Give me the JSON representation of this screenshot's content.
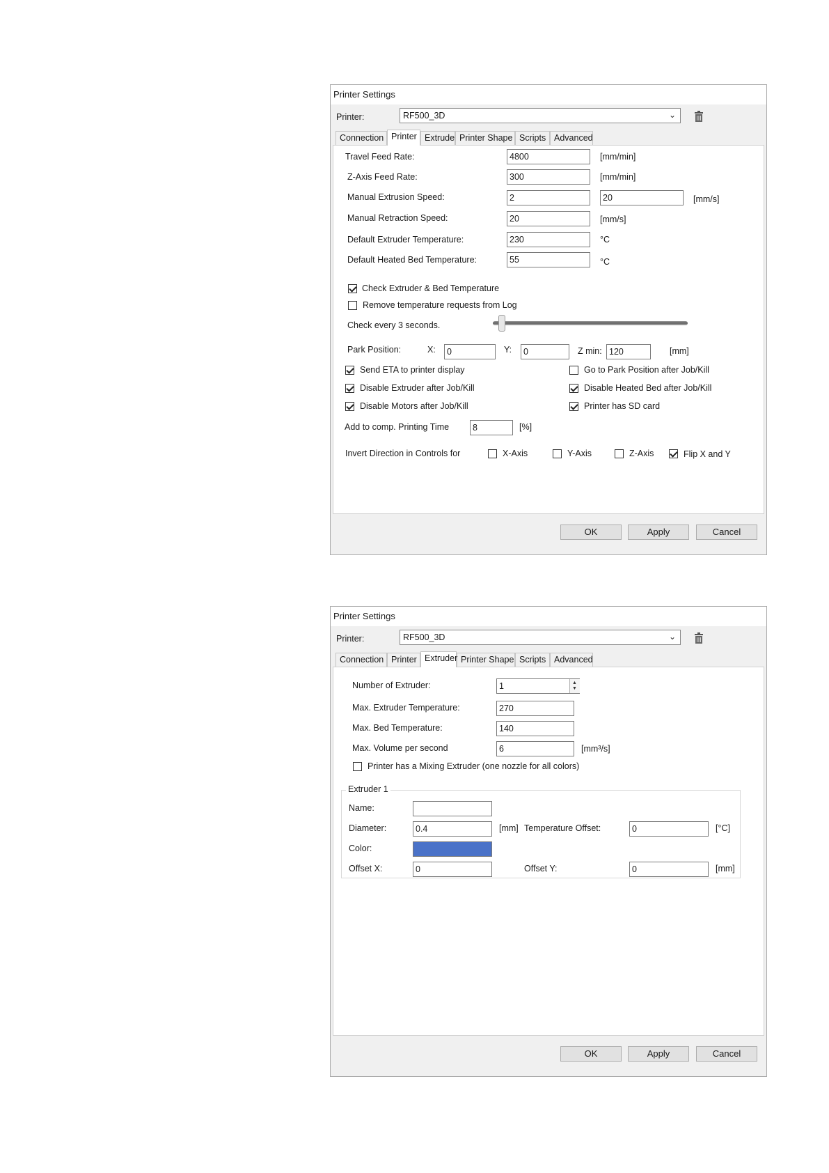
{
  "dialog1": {
    "title": "Printer Settings",
    "printer_label": "Printer:",
    "printer_value": "RF500_3D",
    "tabs": [
      "Connection",
      "Printer",
      "Extruder",
      "Printer Shape",
      "Scripts",
      "Advanced"
    ],
    "active_tab": "Printer",
    "fields": {
      "travel_feed_rate": {
        "label": "Travel Feed Rate:",
        "value": "4800",
        "unit": "[mm/min]"
      },
      "z_axis_feed_rate": {
        "label": "Z-Axis Feed Rate:",
        "value": "300",
        "unit": "[mm/min]"
      },
      "manual_extrusion_speed": {
        "label": "Manual Extrusion Speed:",
        "value": "2",
        "value2": "20",
        "unit": "[mm/s]"
      },
      "manual_retraction_speed": {
        "label": "Manual Retraction Speed:",
        "value": "20",
        "unit": "[mm/s]"
      },
      "default_extruder_temp": {
        "label": "Default Extruder Temperature:",
        "value": "230",
        "unit": "°C"
      },
      "default_bed_temp": {
        "label": "Default Heated Bed Temperature:",
        "value": "55",
        "unit": "°C"
      }
    },
    "check_temp": {
      "label": "Check Extruder & Bed Temperature",
      "checked": true
    },
    "remove_temp_requests": {
      "label": "Remove temperature requests from Log",
      "checked": false
    },
    "check_every": {
      "label": "Check every 3 seconds.",
      "slider_fraction": 0.05
    },
    "park": {
      "label": "Park Position:",
      "x_label": "X:",
      "x_value": "0",
      "y_label": "Y:",
      "y_value": "0",
      "zmin_label": "Z min:",
      "zmin_value": "120",
      "unit": "[mm]"
    },
    "options": {
      "send_eta": {
        "label": "Send ETA to printer display",
        "checked": true
      },
      "go_to_park": {
        "label": "Go to Park Position after Job/Kill",
        "checked": false
      },
      "disable_extruder": {
        "label": "Disable Extruder after Job/Kill",
        "checked": true
      },
      "disable_bed": {
        "label": "Disable Heated Bed after Job/Kill",
        "checked": true
      },
      "disable_motors": {
        "label": "Disable Motors after Job/Kill",
        "checked": true
      },
      "sd_card": {
        "label": "Printer has SD card",
        "checked": true
      }
    },
    "add_comp": {
      "label": "Add to comp. Printing Time",
      "value": "8",
      "unit": "[%]"
    },
    "invert": {
      "label": "Invert Direction in Controls for",
      "x_axis": {
        "label": "X-Axis",
        "checked": false
      },
      "y_axis": {
        "label": "Y-Axis",
        "checked": false
      },
      "z_axis": {
        "label": "Z-Axis",
        "checked": false
      },
      "flip_xy": {
        "label": "Flip X and Y",
        "checked": true
      }
    },
    "buttons": {
      "ok": "OK",
      "apply": "Apply",
      "cancel": "Cancel"
    }
  },
  "dialog2": {
    "title": "Printer Settings",
    "printer_label": "Printer:",
    "printer_value": "RF500_3D",
    "tabs": [
      "Connection",
      "Printer",
      "Extruder",
      "Printer Shape",
      "Scripts",
      "Advanced"
    ],
    "active_tab": "Extruder",
    "num_extruder": {
      "label": "Number of Extruder:",
      "value": "1"
    },
    "max_extruder_temp": {
      "label": "Max. Extruder Temperature:",
      "value": "270"
    },
    "max_bed_temp": {
      "label": "Max. Bed Temperature:",
      "value": "140"
    },
    "max_volume": {
      "label": "Max. Volume per second",
      "value": "6",
      "unit": "[mm³/s]"
    },
    "mixing_extruder": {
      "label": "Printer has a Mixing Extruder (one nozzle for all colors)",
      "checked": false
    },
    "extruder1": {
      "title": "Extruder 1",
      "name_label": "Name:",
      "name_value": "",
      "diameter_label": "Diameter:",
      "diameter_value": "0.4",
      "diameter_unit": "[mm]",
      "temp_offset_label": "Temperature Offset:",
      "temp_offset_value": "0",
      "temp_offset_unit": "[°C]",
      "color_label": "Color:",
      "color_value": "#4a72c8",
      "offset_x_label": "Offset X:",
      "offset_x_value": "0",
      "offset_y_label": "Offset Y:",
      "offset_y_value": "0",
      "offset_unit": "[mm]"
    },
    "buttons": {
      "ok": "OK",
      "apply": "Apply",
      "cancel": "Cancel"
    }
  }
}
